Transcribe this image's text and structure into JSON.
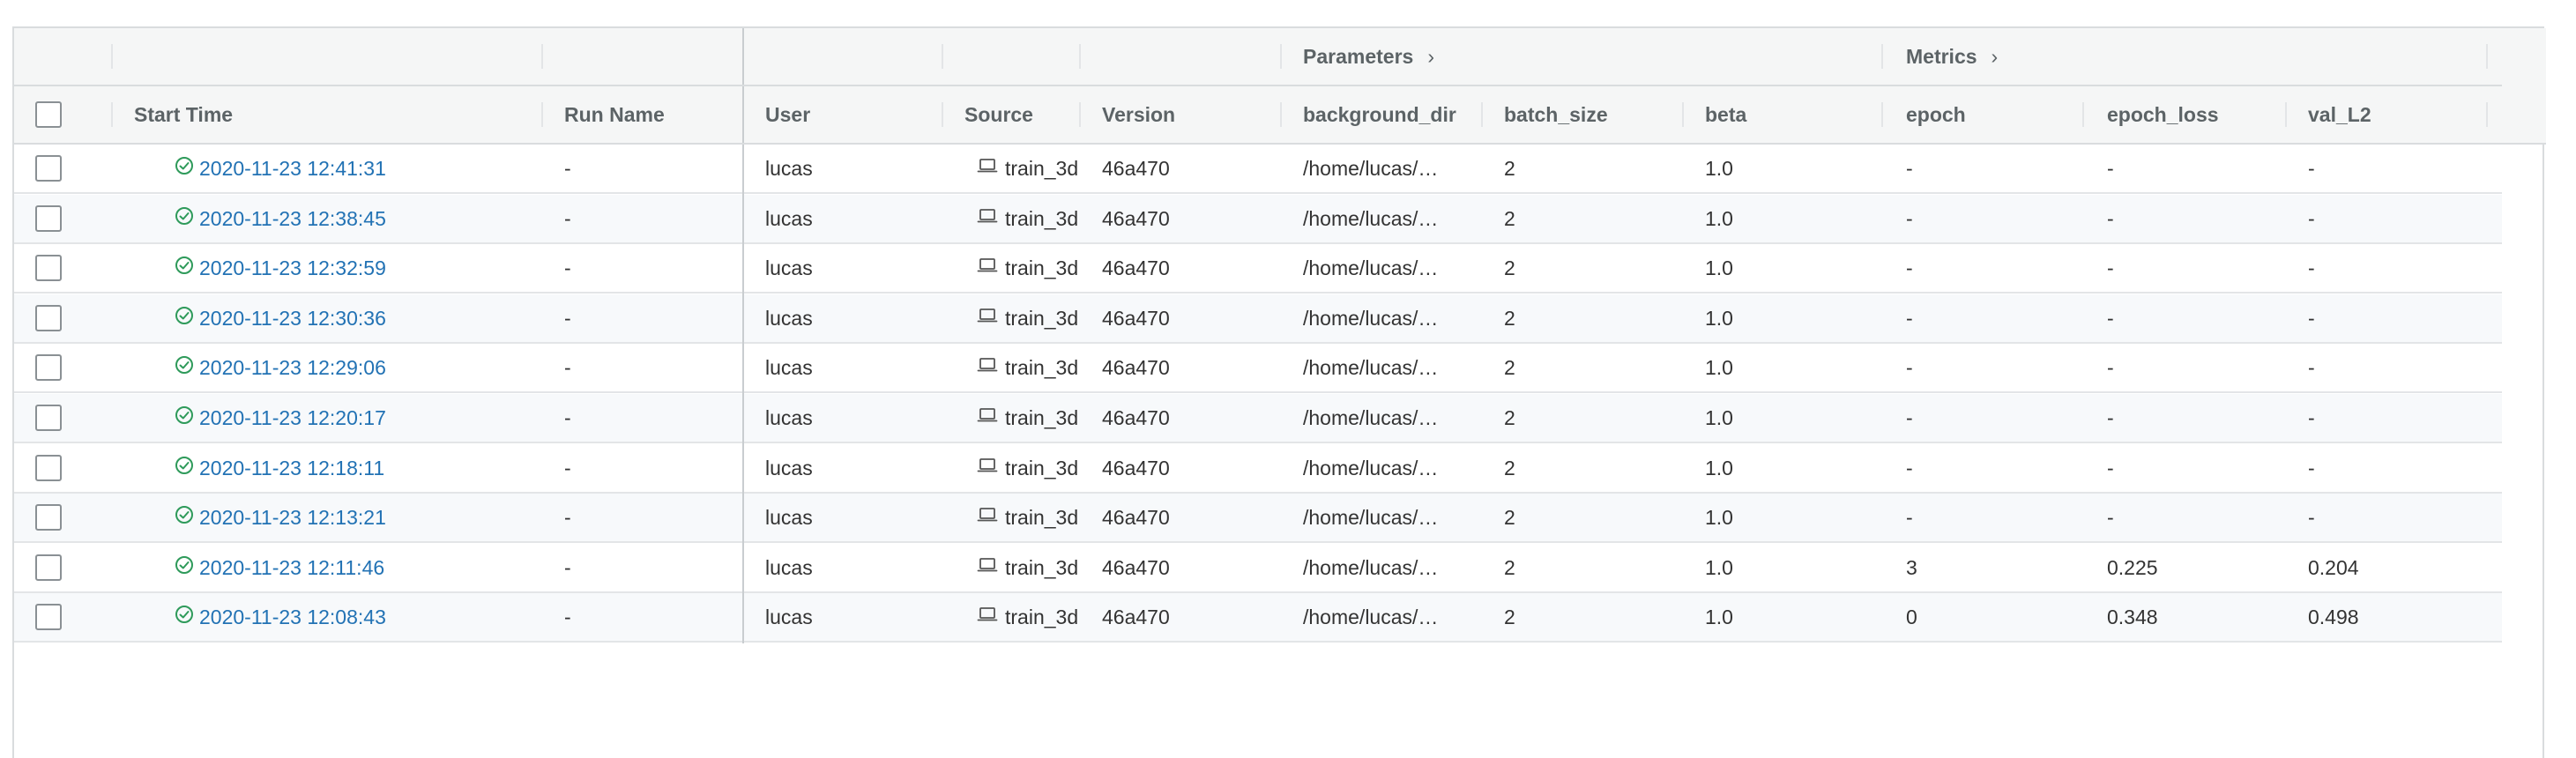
{
  "table": {
    "groups": {
      "parameters": "Parameters",
      "metrics": "Metrics",
      "chevron": "›"
    },
    "columns": {
      "start_time": "Start Time",
      "run_name": "Run Name",
      "user": "User",
      "source": "Source",
      "version": "Version",
      "background_dir": "background_dir",
      "batch_size": "batch_size",
      "beta": "beta",
      "epoch": "epoch",
      "epoch_loss": "epoch_loss",
      "val_L2": "val_L2"
    },
    "colors": {
      "link": "#2272b4",
      "success": "#2e9a5a",
      "header_bg": "#f5f6f6"
    },
    "icons": {
      "status": "check-circle-icon",
      "source": "laptop-icon",
      "chevron": "chevron-right-icon"
    },
    "rows": [
      {
        "start_time": "2020-11-23 12:41:31",
        "run_name": "-",
        "user": "lucas",
        "source": "train_3dı",
        "version": "46a470",
        "background_dir": "/home/lucas/…",
        "batch_size": "2",
        "beta": "1.0",
        "epoch": "-",
        "epoch_loss": "-",
        "val_L2": "-"
      },
      {
        "start_time": "2020-11-23 12:38:45",
        "run_name": "-",
        "user": "lucas",
        "source": "train_3dı",
        "version": "46a470",
        "background_dir": "/home/lucas/…",
        "batch_size": "2",
        "beta": "1.0",
        "epoch": "-",
        "epoch_loss": "-",
        "val_L2": "-"
      },
      {
        "start_time": "2020-11-23 12:32:59",
        "run_name": "-",
        "user": "lucas",
        "source": "train_3dı",
        "version": "46a470",
        "background_dir": "/home/lucas/…",
        "batch_size": "2",
        "beta": "1.0",
        "epoch": "-",
        "epoch_loss": "-",
        "val_L2": "-"
      },
      {
        "start_time": "2020-11-23 12:30:36",
        "run_name": "-",
        "user": "lucas",
        "source": "train_3dı",
        "version": "46a470",
        "background_dir": "/home/lucas/…",
        "batch_size": "2",
        "beta": "1.0",
        "epoch": "-",
        "epoch_loss": "-",
        "val_L2": "-"
      },
      {
        "start_time": "2020-11-23 12:29:06",
        "run_name": "-",
        "user": "lucas",
        "source": "train_3dı",
        "version": "46a470",
        "background_dir": "/home/lucas/…",
        "batch_size": "2",
        "beta": "1.0",
        "epoch": "-",
        "epoch_loss": "-",
        "val_L2": "-"
      },
      {
        "start_time": "2020-11-23 12:20:17",
        "run_name": "-",
        "user": "lucas",
        "source": "train_3dı",
        "version": "46a470",
        "background_dir": "/home/lucas/…",
        "batch_size": "2",
        "beta": "1.0",
        "epoch": "-",
        "epoch_loss": "-",
        "val_L2": "-"
      },
      {
        "start_time": "2020-11-23 12:18:11",
        "run_name": "-",
        "user": "lucas",
        "source": "train_3dı",
        "version": "46a470",
        "background_dir": "/home/lucas/…",
        "batch_size": "2",
        "beta": "1.0",
        "epoch": "-",
        "epoch_loss": "-",
        "val_L2": "-"
      },
      {
        "start_time": "2020-11-23 12:13:21",
        "run_name": "-",
        "user": "lucas",
        "source": "train_3dı",
        "version": "46a470",
        "background_dir": "/home/lucas/…",
        "batch_size": "2",
        "beta": "1.0",
        "epoch": "-",
        "epoch_loss": "-",
        "val_L2": "-"
      },
      {
        "start_time": "2020-11-23 12:11:46",
        "run_name": "-",
        "user": "lucas",
        "source": "train_3dı",
        "version": "46a470",
        "background_dir": "/home/lucas/…",
        "batch_size": "2",
        "beta": "1.0",
        "epoch": "3",
        "epoch_loss": "0.225",
        "val_L2": "0.204"
      },
      {
        "start_time": "2020-11-23 12:08:43",
        "run_name": "-",
        "user": "lucas",
        "source": "train_3dı",
        "version": "46a470",
        "background_dir": "/home/lucas/…",
        "batch_size": "2",
        "beta": "1.0",
        "epoch": "0",
        "epoch_loss": "0.348",
        "val_L2": "0.498"
      }
    ]
  }
}
